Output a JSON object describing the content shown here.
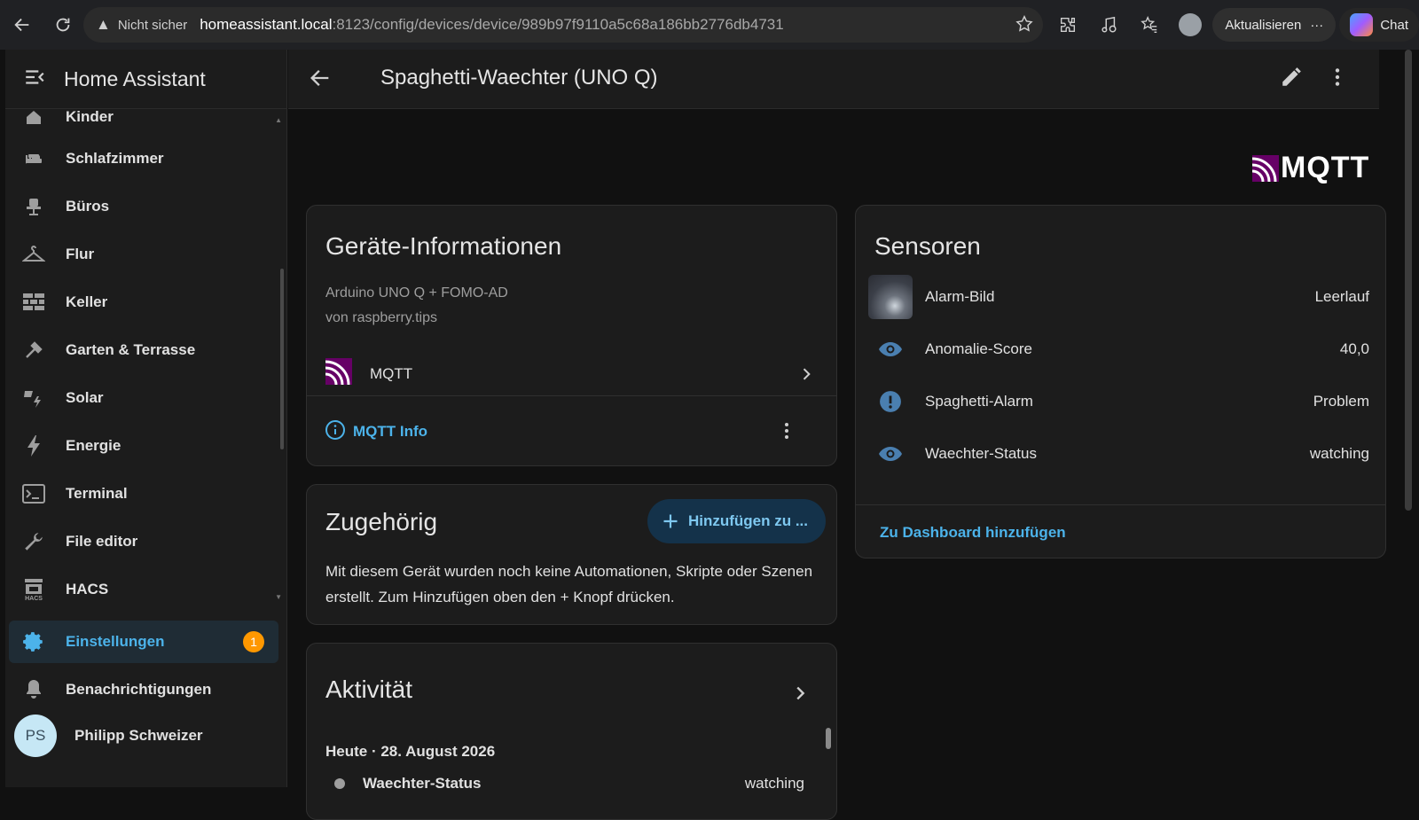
{
  "browser": {
    "security_label": "Nicht sicher",
    "url_host": "homeassistant.local",
    "url_path": ":8123/config/devices/device/989b97f9110a5c68a186bb2776db4731",
    "update_label": "Aktualisieren",
    "update_more": "···",
    "chat_label": "Chat"
  },
  "sidebar": {
    "title": "Home Assistant",
    "partial_item": "Kinder",
    "items": [
      {
        "label": "Schlafzimmer",
        "icon": "bed-icon"
      },
      {
        "label": "Büros",
        "icon": "office-chair-icon"
      },
      {
        "label": "Flur",
        "icon": "hanger-icon"
      },
      {
        "label": "Keller",
        "icon": "wall-icon"
      },
      {
        "label": "Garten & Terrasse",
        "icon": "shovel-icon"
      },
      {
        "label": "Solar",
        "icon": "solar-power-icon"
      },
      {
        "label": "Energie",
        "icon": "lightning-icon"
      },
      {
        "label": "Terminal",
        "icon": "console-icon"
      },
      {
        "label": "File editor",
        "icon": "wrench-icon"
      },
      {
        "label": "HACS",
        "icon": "hacs-icon"
      }
    ],
    "settings_label": "Einstellungen",
    "settings_badge": "1",
    "notifications_label": "Benachrichtigungen",
    "user_initials": "PS",
    "user_name": "Philipp Schweizer",
    "hacs_small": "HACS"
  },
  "topbar": {
    "title": "Spaghetti-Waechter (UNO Q)"
  },
  "integration_logo": "MQTT",
  "device_info": {
    "title": "Geräte-Informationen",
    "model": "Arduino UNO Q + FOMO-AD",
    "vendor": "von raspberry.tips",
    "integration": "MQTT",
    "info_link": "MQTT Info"
  },
  "related": {
    "title": "Zugehörig",
    "add_button": "Hinzufügen zu ...",
    "description": "Mit diesem Gerät wurden noch keine Automationen, Skripte oder Szenen erstellt. Zum Hinzufügen oben den + Knopf drücken."
  },
  "activity": {
    "title": "Aktivität",
    "date": "Heute · 28. August 2026",
    "entries": [
      {
        "name": "Waechter-Status",
        "value": "watching"
      }
    ]
  },
  "sensors": {
    "title": "Sensoren",
    "rows": [
      {
        "name": "Alarm-Bild",
        "state": "Leerlauf",
        "icon": "image-thumbnail"
      },
      {
        "name": "Anomalie-Score",
        "state": "40,0",
        "icon": "eye-icon"
      },
      {
        "name": "Spaghetti-Alarm",
        "state": "Problem",
        "icon": "alert-circle-icon"
      },
      {
        "name": "Waechter-Status",
        "state": "watching",
        "icon": "eye-icon"
      }
    ],
    "footer_link": "Zu Dashboard hinzufügen"
  },
  "colors": {
    "accent": "#4cb3ea",
    "badge": "#ff9800",
    "background": "#111111",
    "card": "#1c1c1c",
    "mqtt_purple": "#660066"
  }
}
